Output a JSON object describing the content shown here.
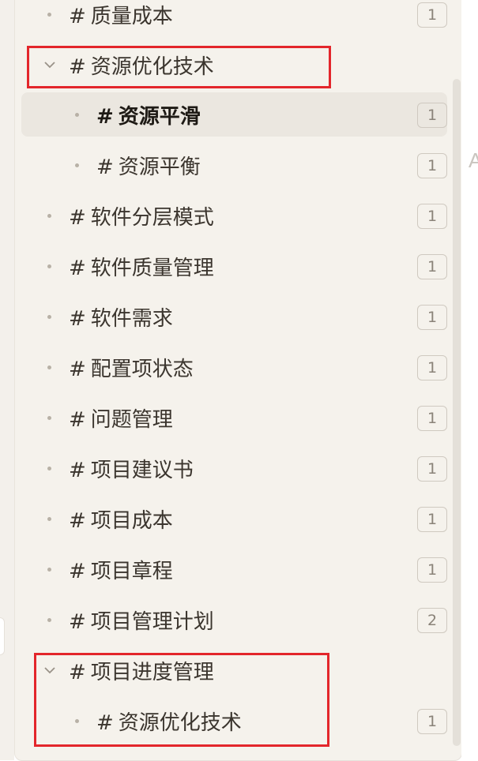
{
  "tags": [
    {
      "label": "质量成本",
      "count": "1"
    },
    {
      "label": "资源优化技术",
      "count": ""
    },
    {
      "label": "资源平滑",
      "count": "1"
    },
    {
      "label": "资源平衡",
      "count": "1"
    },
    {
      "label": "软件分层模式",
      "count": "1"
    },
    {
      "label": "软件质量管理",
      "count": "1"
    },
    {
      "label": "软件需求",
      "count": "1"
    },
    {
      "label": "配置项状态",
      "count": "1"
    },
    {
      "label": "问题管理",
      "count": "1"
    },
    {
      "label": "项目建议书",
      "count": "1"
    },
    {
      "label": "项目成本",
      "count": "1"
    },
    {
      "label": "项目章程",
      "count": "1"
    },
    {
      "label": "项目管理计划",
      "count": "2"
    },
    {
      "label": "项目进度管理",
      "count": ""
    },
    {
      "label": "资源优化技术",
      "count": "1"
    }
  ],
  "hash_symbol": "#",
  "right_glyph": "A",
  "colors": {
    "highlight": "#e3262b",
    "panel": "#f5f2ec",
    "active_row": "#ebe7e0"
  }
}
